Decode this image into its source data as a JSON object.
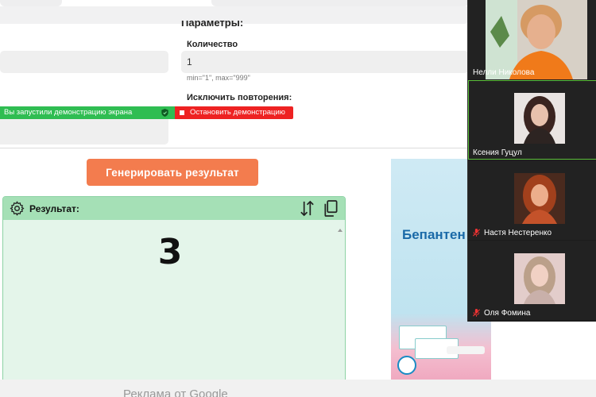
{
  "params": {
    "heading": "Параметры:",
    "quantity_label": "Количество",
    "quantity_value": "1",
    "quantity_hint": "min=\"1\", max=\"999\"",
    "exclude_label": "Исключить повторения:"
  },
  "share_bar": {
    "status_text": "Вы запустили демонстрацию экрана",
    "stop_label": "Остановить демонстрацию",
    "green": "#2fbd52",
    "red": "#ee2222"
  },
  "generate_button": {
    "label": "Генерировать результат",
    "color": "#f37c4e"
  },
  "result": {
    "title": "Результат:",
    "value": "3",
    "header_color": "#a5e0b6",
    "body_color": "#e4f5ea"
  },
  "ad": {
    "brand": "Бепантен"
  },
  "footer": {
    "text": "Реклама от Google"
  },
  "participants": [
    {
      "name": "Нелли Николова",
      "muted": false
    },
    {
      "name": "Ксения Гуцул",
      "muted": false,
      "active": true
    },
    {
      "name": "Настя Нестеренко",
      "muted": true
    },
    {
      "name": "Оля Фомина",
      "muted": true
    }
  ]
}
